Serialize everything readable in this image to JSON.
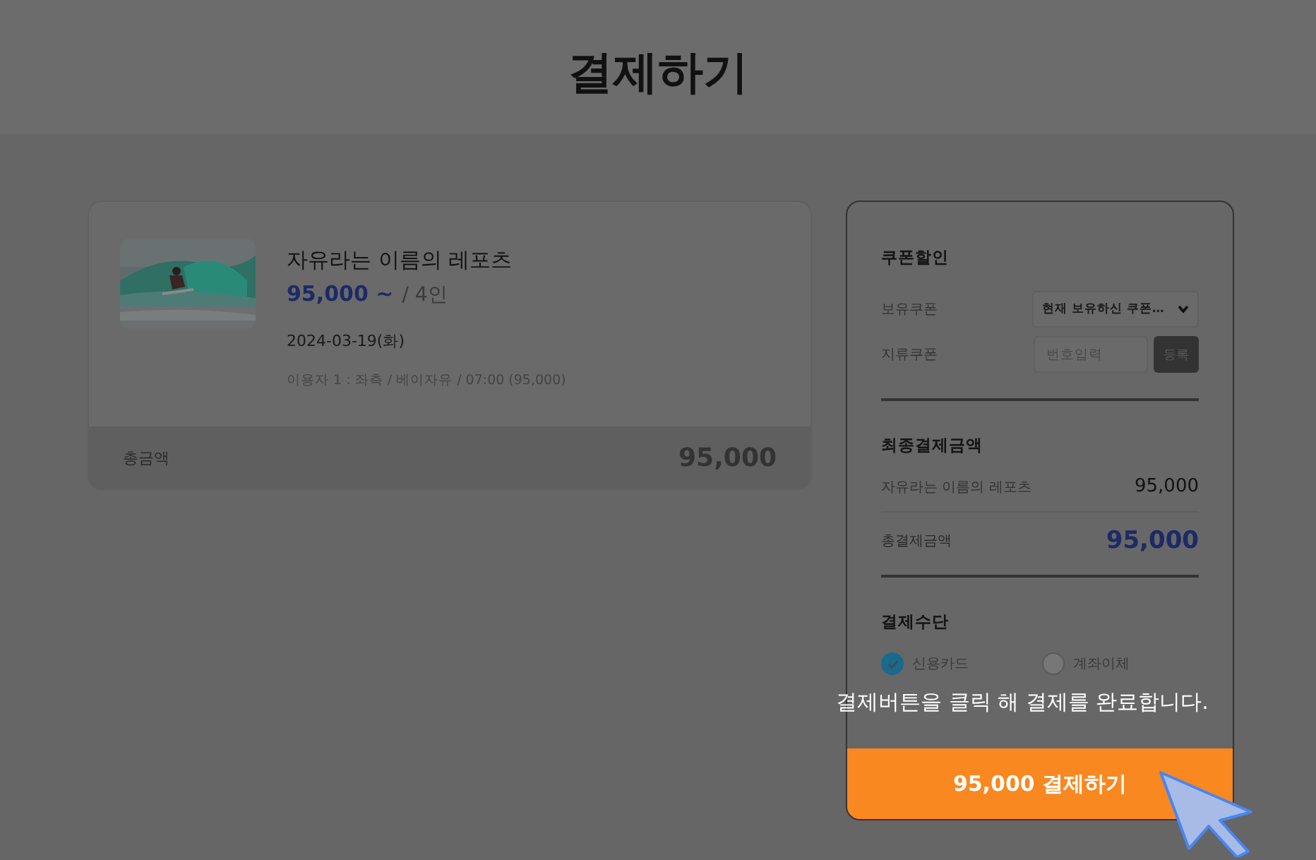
{
  "page": {
    "title": "결제하기"
  },
  "product": {
    "name": "자유라는 이름의 레포츠",
    "price": "95,000 ~",
    "per": "/ 4인",
    "date": "2024-03-19(화)",
    "detail": "이용자 1 : 좌측 / 베이자유 / 07:00 (95,000)",
    "total_label": "총금액",
    "total": "95,000"
  },
  "coupon": {
    "title": "쿠폰할인",
    "owned_label": "보유쿠폰",
    "owned_value": "현재 보유하신 쿠폰…",
    "paper_label": "지류쿠폰",
    "paper_placeholder": "번호입력",
    "register": "등록"
  },
  "summary": {
    "title": "최종결제금액",
    "item": "자유라는 이름의 레포츠",
    "item_amount": "95,000",
    "total_label": "총결제금액",
    "total": "95,000"
  },
  "payment": {
    "title": "결제수단",
    "methods": [
      {
        "label": "신용카드",
        "selected": true
      },
      {
        "label": "계좌이체",
        "selected": false
      }
    ]
  },
  "hint": "결제버튼을 클릭 해 결제를 완료합니다.",
  "pay_button": "95,000 결제하기"
}
